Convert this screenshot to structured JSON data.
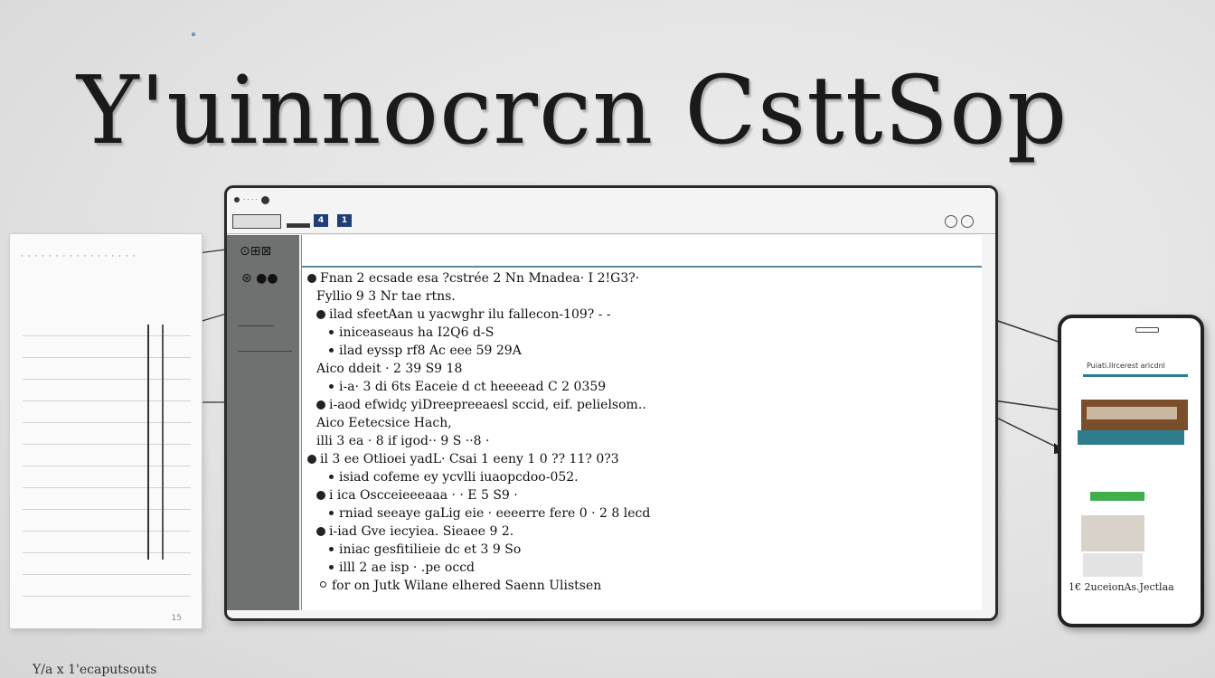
{
  "headline": "Y'uinnocrcn CsttSop",
  "notebook": {
    "top_text": "· · · · · · · · · · · · · · · · ·",
    "page_number": "15",
    "caption": "Y/a x 1'ecaputsouts"
  },
  "monitor": {
    "window_title": "· · · ·",
    "toolbar_badges": [
      "4",
      "1"
    ],
    "sidebar_icons": [
      "⊙⊞⊠",
      "⊛ ●●"
    ],
    "lines": [
      {
        "bullet": "big",
        "indent": 0,
        "text": "Fnan 2 ecsade esa  ?cstrée 2 Nn Mnadea· I 2!G3?·"
      },
      {
        "bullet": "none",
        "indent": 1,
        "text": "Fyllio 9 3 Nr tae rtns."
      },
      {
        "bullet": "big",
        "indent": 1,
        "text": "ilad sfeetAan u yacwghr ilu fallecon-109? - -"
      },
      {
        "bullet": "small",
        "indent": 1,
        "text": "iniceaseaus ha I2Q6 d-S"
      },
      {
        "bullet": "small",
        "indent": 1,
        "text": "ilad eyssp rf8 Ac eee 59 29A"
      },
      {
        "bullet": "none",
        "indent": 1,
        "text": "Aico ddeit · 2 39 S9 18"
      },
      {
        "bullet": "small",
        "indent": 1,
        "text": "i-a· 3 di 6ts  Eaceie d ct heeeead  C 2 0359"
      },
      {
        "bullet": "big",
        "indent": 1,
        "text": "i-aod  efwidç yiDreepreeaesl sccid, eif. pelielsom.."
      },
      {
        "bullet": "none",
        "indent": 1,
        "text": "Aico Eetecsice  Hach,"
      },
      {
        "bullet": "none",
        "indent": 1,
        "text": "illi 3 ea  · 8 if igod·· 9 S ··8 ·"
      },
      {
        "bullet": "big",
        "indent": 0,
        "text": "il 3 ee Otlioei yadL· Csai 1 eeny  1 0 ?? 11? 0?3"
      },
      {
        "bullet": "small",
        "indent": 1,
        "text": "isiad cofeme ey ycvlli iuaopcdoo-052."
      },
      {
        "bullet": "big",
        "indent": 1,
        "text": "i ica Oscceieeeaaa · · E 5 S9 ·"
      },
      {
        "bullet": "small",
        "indent": 1,
        "text": "rniad seeaye gaLig eie · eeeerre fere 0 · 2 8 lecd"
      },
      {
        "bullet": "big",
        "indent": 1,
        "text": "i-iad Gve iecyiea. Sieaee 9 2."
      },
      {
        "bullet": "small",
        "indent": 1,
        "text": "iniac gesfitilieie dc et 3 9 So"
      },
      {
        "bullet": "small",
        "indent": 1,
        "text": "illl 2 ae isp ·  .pe occd"
      },
      {
        "bullet": "small-ring",
        "indent": 0,
        "text": "for on Jutk Wilane elhered Saenn Ulistsen"
      }
    ]
  },
  "phone": {
    "header": "Puiati.Ilrcerest aricdnl",
    "caption": "1€ 2uceionAs.Jectlaa"
  }
}
